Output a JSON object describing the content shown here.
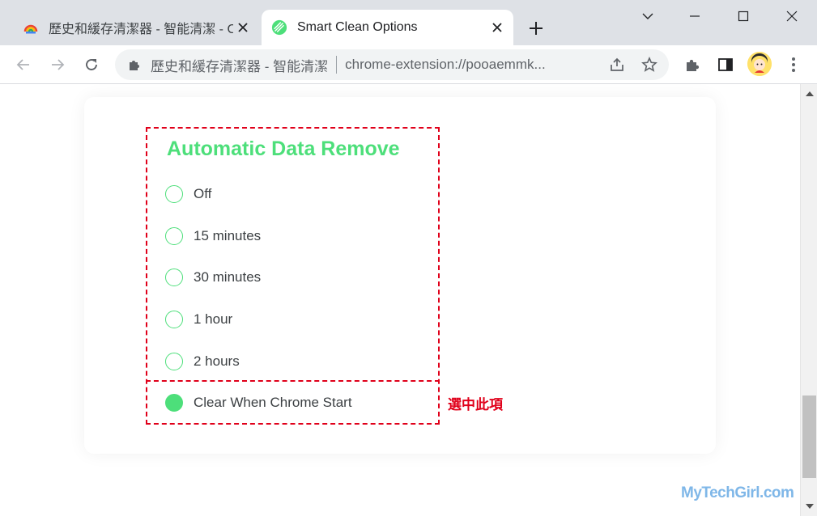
{
  "browser": {
    "tabs": [
      {
        "title": "歷史和緩存清潔器 - 智能清潔 - C",
        "favicon": "chrome-rainbow-icon",
        "active": false
      },
      {
        "title": "Smart Clean Options",
        "favicon": "smart-clean-leaf-icon",
        "active": true
      }
    ],
    "new_tab": "+",
    "window_controls": [
      "chevron-down-icon",
      "minimize-icon",
      "maximize-icon",
      "close-icon"
    ],
    "toolbar": {
      "back": "back-arrow-icon",
      "forward": "forward-arrow-icon",
      "reload": "reload-icon",
      "site_name": "歷史和緩存清潔器 - 智能清潔",
      "url": "chrome-extension://pooaemmk...",
      "share": "share-icon",
      "bookmark": "star-icon",
      "extensions": "puzzle-icon",
      "side_panel": "side-panel-icon",
      "avatar": "profile-avatar",
      "menu": "kebab-menu-icon"
    }
  },
  "page": {
    "section_title": "Automatic Data Remove",
    "options": [
      {
        "label": "Off",
        "checked": false
      },
      {
        "label": "15 minutes",
        "checked": false
      },
      {
        "label": "30 minutes",
        "checked": false
      },
      {
        "label": "1 hour",
        "checked": false
      },
      {
        "label": "2 hours",
        "checked": false
      },
      {
        "label": "Clear When Chrome Start",
        "checked": true
      }
    ],
    "annotation": "選中此項",
    "watermark": "MyTechGirl.com"
  },
  "colors": {
    "accent_green": "#4ddf7a",
    "annotation_red": "#e0001a",
    "tabstrip": "#dee1e6"
  }
}
